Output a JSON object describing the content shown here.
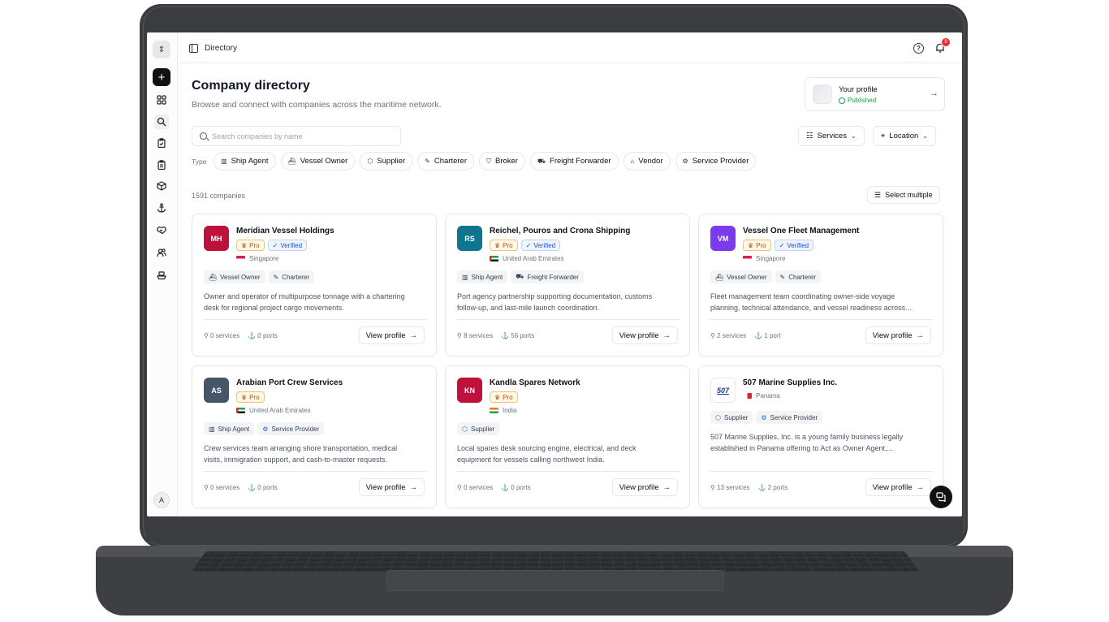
{
  "topbar": {
    "title": "Directory",
    "help_icon": "help-circle-icon",
    "bell_icon": "bell-icon",
    "notification_count": "9"
  },
  "sidebar": {
    "avatar_initial": "A",
    "items": [
      "new",
      "grid",
      "search",
      "clipboard-check",
      "clipboard",
      "package",
      "anchor",
      "handshake",
      "users",
      "ship"
    ]
  },
  "header": {
    "title": "Company directory",
    "subtitle": "Browse and connect with companies across the maritime network."
  },
  "profile": {
    "label": "Your profile",
    "status": "Published"
  },
  "search": {
    "placeholder": "Search companies by name"
  },
  "filters": {
    "services": "Services",
    "location": "Location"
  },
  "type_filter": {
    "label": "Type",
    "chips": [
      "Ship Agent",
      "Vessel Owner",
      "Supplier",
      "Charterer",
      "Broker",
      "Freight Forwarder",
      "Vendor",
      "Service Provider"
    ]
  },
  "results": {
    "count": "1591 companies",
    "select_multiple": "Select multiple"
  },
  "companies": [
    {
      "initials": "MH",
      "color": "#be123c",
      "name": "Meridian Vessel Holdings",
      "pro": "Pro",
      "verified": "Verified",
      "country": "Singapore",
      "tags": [
        "Vessel Owner",
        "Charterer"
      ],
      "desc1": "Owner and operator of multipurpose tonnage with a chartering",
      "desc2": "desk for regional project cargo movements.",
      "services": "0 services",
      "ports": "0 ports",
      "cta": "View profile"
    },
    {
      "initials": "RS",
      "color": "#0e7490",
      "name": "Reichel, Pouros and Crona Shipping",
      "pro": "Pro",
      "verified": "Verified",
      "country": "United Arab Emirates",
      "tags": [
        "Ship Agent",
        "Freight Forwarder"
      ],
      "desc1": "Port agency partnership supporting documentation, customs",
      "desc2": "follow-up, and last-mile launch coordination.",
      "services": "8 services",
      "ports": "56 ports",
      "cta": "View profile"
    },
    {
      "initials": "VM",
      "color": "#7c3aed",
      "name": "Vessel One Fleet Management",
      "pro": "Pro",
      "verified": "Verified",
      "country": "Singapore",
      "tags": [
        "Vessel Owner",
        "Charterer"
      ],
      "desc1": "Fleet management team coordinating owner-side voyage",
      "desc2": "planning, technical attendance, and vessel readiness across...",
      "services": "2 services",
      "ports": "1 port",
      "cta": "View profile"
    },
    {
      "initials": "AS",
      "color": "#475569",
      "name": "Arabian Port Crew Services",
      "pro": "Pro",
      "verified": "",
      "country": "United Arab Emirates",
      "tags": [
        "Ship Agent",
        "Service Provider"
      ],
      "desc1": "Crew services team arranging shore transportation, medical",
      "desc2": "visits, immigration support, and cash-to-master requests.",
      "services": "0 services",
      "ports": "0 ports",
      "cta": "View profile"
    },
    {
      "initials": "KN",
      "color": "#be123c",
      "name": "Kandla Spares Network",
      "pro": "Pro",
      "verified": "",
      "country": "India",
      "tags": [
        "Supplier"
      ],
      "desc1": "Local spares desk sourcing engine, electrical, and deck",
      "desc2": "equipment for vessels calling northwest India.",
      "services": "0 services",
      "ports": "0 ports",
      "cta": "View profile"
    },
    {
      "initials": "507",
      "color": "#ffffff",
      "name": "507 Marine Supplies Inc.",
      "pro": "",
      "verified": "",
      "country": "Panama",
      "tags": [
        "Supplier",
        "Service Provider"
      ],
      "desc1": "507 Marine Supplies, Inc. is a young family business legally",
      "desc2": "established in Panama offering to Act as Owner Agent,...",
      "services": "13 services",
      "ports": "2 ports",
      "cta": "View profile"
    }
  ]
}
